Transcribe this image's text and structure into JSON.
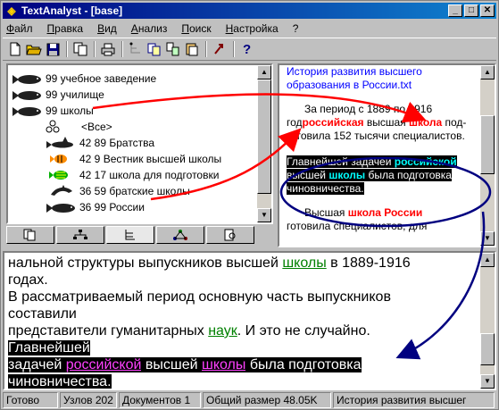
{
  "window": {
    "title": "TextAnalyst - [base]"
  },
  "menu": [
    "Файл",
    "Правка",
    "Вид",
    "Анализ",
    "Поиск",
    "Настройка",
    "?"
  ],
  "toolbar": {
    "icons": [
      "new-file-icon",
      "open-folder-icon",
      "save-icon",
      "copy-icon",
      "print-icon",
      "tree-link-icon",
      "copy-pages-icon",
      "merge-pages-icon",
      "paste-pages-icon",
      "pointer-icon",
      "help-icon"
    ]
  },
  "tree": {
    "items": [
      {
        "label": "99 учебное заведение",
        "icon": "whale-icon"
      },
      {
        "label": "99 училище",
        "icon": "whale-icon"
      },
      {
        "label": "99 школы",
        "icon": "whale-icon"
      },
      {
        "label": "<Все>",
        "icon": "nodes-icon"
      },
      {
        "label": "42 89 Братства",
        "icon": "shark-icon"
      },
      {
        "label": "42 9 Вестник высшей школы",
        "icon": "fish-icon"
      },
      {
        "label": "42 17 школа для подготовки",
        "icon": "fish-icon"
      },
      {
        "label": "36 59 братские школы",
        "icon": "dolphin-icon"
      },
      {
        "label": "36 99 России",
        "icon": "whale-icon"
      }
    ]
  },
  "tabs": [
    {
      "icon": "pages-icon",
      "active": false
    },
    {
      "icon": "tree-icon",
      "active": false
    },
    {
      "icon": "hierarchy-icon",
      "active": true
    },
    {
      "icon": "network-icon",
      "active": false
    },
    {
      "icon": "doc-search-icon",
      "active": false
    }
  ],
  "right_panel": {
    "title": "История развития высшего образования в России.txt",
    "p1_a": "За период с 1889 по 1916 год",
    "p1_kw1": "российская",
    "p1_b": " высшая ",
    "p1_kw2": "школа",
    "p1_c": " под-готовила 152 тысячи специалистов.",
    "p2_a": "Главнейшей задачей",
    "p2_kw1": "российской",
    "p2_b": " высшей ",
    "p2_kw2": "школы",
    "p2_c": " была подготовка чиновничества.",
    "p3_a": "Высшая ",
    "p3_kw": "школа России",
    "p3_b": "готовила специалистов, для"
  },
  "bottom_panel": {
    "l1_a": "нальной структуры  выпускников высшей ",
    "l1_kw": "школы",
    "l1_b": " в 1889-1916",
    "l2": "годах.",
    "l3": "В рассматриваемый период основную часть выпускников",
    "l4": "составили",
    "l5_a": "представители гуманитарных ",
    "l5_kw": "наук",
    "l5_b": ". И это не случайно.",
    "l6": "Главнейшей ",
    "l7_a": "задачей ",
    "l7_kw1": "российской",
    "l7_b": " высшей ",
    "l7_kw2": "школы",
    "l7_c": " была подготовка",
    "l8": "чиновничества."
  },
  "status": {
    "ready": "Готово",
    "nodes": "Узлов 202",
    "docs": "Документов 1",
    "size": "Общий размер 48.05K",
    "doc_name": "История развития высшег"
  },
  "colors": {
    "titlebar": "#000080",
    "keyword_red": "#ff0000",
    "keyword_cyan": "#00ffff",
    "keyword_green": "#008000",
    "keyword_magenta": "#ff40ff",
    "annotation_red": "#ff0000",
    "annotation_blue": "#000080"
  }
}
